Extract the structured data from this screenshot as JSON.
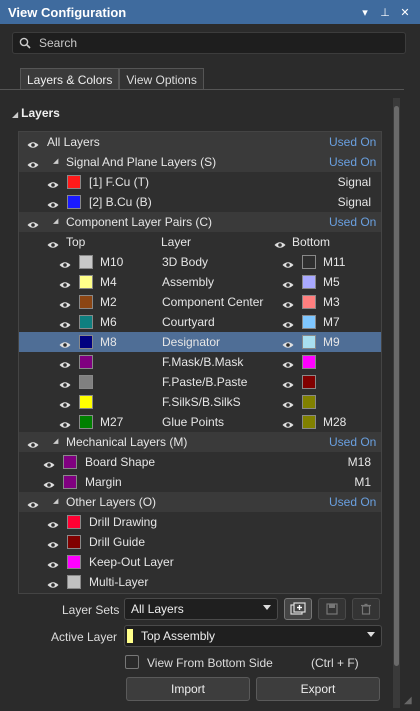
{
  "window": {
    "title": "View Configuration",
    "controls": [
      "▾",
      "⊥",
      "✕"
    ]
  },
  "search": {
    "placeholder": "Search"
  },
  "tabs": [
    {
      "label": "Layers & Colors",
      "active": true
    },
    {
      "label": "View Options",
      "active": false
    }
  ],
  "section": {
    "label": "Layers"
  },
  "colors": {
    "accent": "#3f6b9e",
    "used_on": "#6aa0e0",
    "selection": "#4f6e96"
  },
  "grid": {
    "all_layers": {
      "label": "All Layers",
      "status": "Used On"
    },
    "signal_group": {
      "label": "Signal And Plane Layers (S)",
      "status": "Used On"
    },
    "signal_layers": [
      {
        "label": "[1] F.Cu (T)",
        "type": "Signal",
        "color": "#ff1a1a"
      },
      {
        "label": "[2] B.Cu (B)",
        "type": "Signal",
        "color": "#1a1aff"
      }
    ],
    "pairs_group": {
      "label": "Component Layer Pairs (C)",
      "status": "Used On"
    },
    "pairs_header": {
      "top": "Top",
      "layer": "Layer",
      "bottom": "Bottom"
    },
    "pairs": [
      {
        "top": "M10",
        "top_color": "#c8c8c8",
        "layer": "3D Body",
        "bottom": "M11",
        "bottom_color": "#2e2e2e"
      },
      {
        "top": "M4",
        "top_color": "#ffff8a",
        "layer": "Assembly",
        "bottom": "M5",
        "bottom_color": "#a9a9ff"
      },
      {
        "top": "M2",
        "top_color": "#8b4513",
        "layer": "Component Center",
        "bottom": "M3",
        "bottom_color": "#ff7f7f"
      },
      {
        "top": "M6",
        "top_color": "#0f7f7f",
        "layer": "Courtyard",
        "bottom": "M7",
        "bottom_color": "#7fc7ff"
      },
      {
        "top": "M8",
        "top_color": "#00007f",
        "layer": "Designator",
        "bottom": "M9",
        "bottom_color": "#a8dff0",
        "selected": true
      },
      {
        "top": "",
        "top_color": "#800080",
        "layer": "F.Mask/B.Mask",
        "bottom": "",
        "bottom_color": "#ff00ff"
      },
      {
        "top": "",
        "top_color": "#808080",
        "layer": "F.Paste/B.Paste",
        "bottom": "",
        "bottom_color": "#800000"
      },
      {
        "top": "",
        "top_color": "#ffff00",
        "layer": "F.SilkS/B.SilkS",
        "bottom": "",
        "bottom_color": "#808000"
      },
      {
        "top": "M27",
        "top_color": "#008000",
        "layer": "Glue Points",
        "bottom": "M28",
        "bottom_color": "#808000"
      }
    ],
    "mech_group": {
      "label": "Mechanical Layers (M)",
      "status": "Used On"
    },
    "mech_layers": [
      {
        "label": "Board Shape",
        "value": "M18",
        "color": "#800080"
      },
      {
        "label": "Margin",
        "value": "M1",
        "color": "#800080"
      }
    ],
    "other_group": {
      "label": "Other Layers (O)",
      "status": "Used On"
    },
    "other_layers": [
      {
        "label": "Drill Drawing",
        "color": "#ff0033"
      },
      {
        "label": "Drill Guide",
        "color": "#800000"
      },
      {
        "label": "Keep-Out Layer",
        "color": "#ff00ff"
      },
      {
        "label": "Multi-Layer",
        "color": "#c0c0c0"
      }
    ]
  },
  "bottom": {
    "layer_sets_label": "Layer Sets",
    "layer_sets_value": "All Layers",
    "active_layer_label": "Active Layer",
    "active_layer_value": "Top Assembly",
    "active_layer_color": "#ffff8a",
    "view_from_bottom_label": "View From Bottom Side",
    "view_from_bottom_shortcut": "(Ctrl + F)",
    "import_label": "Import",
    "export_label": "Export"
  }
}
